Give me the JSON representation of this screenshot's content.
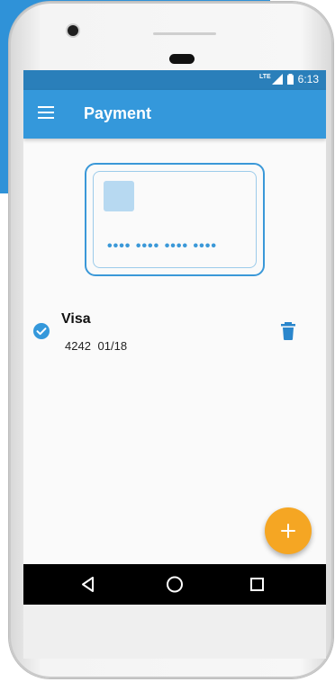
{
  "status_bar": {
    "time": "6:13",
    "network_label": "LTE"
  },
  "app_bar": {
    "title": "Payment"
  },
  "card_preview": {
    "masked_number": "•••• •••• •••• ••••"
  },
  "payment_method": {
    "brand": "Visa",
    "last4": "4242",
    "expiry": "01/18",
    "selected": true
  },
  "colors": {
    "primary": "#3498db",
    "primary_dark": "#2a7fba",
    "accent": "#f5a623"
  }
}
